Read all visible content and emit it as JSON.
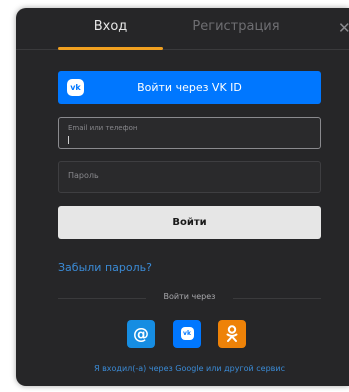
{
  "tabs": {
    "login": "Вход",
    "register": "Регистрация"
  },
  "close_icon": "close-icon",
  "vk_button": {
    "label": "Войти через VK ID",
    "logo_text": "vk",
    "icon": "vk-logo-icon"
  },
  "email": {
    "placeholder": "Email или телефон",
    "value": ""
  },
  "password": {
    "placeholder": "Пароль",
    "value": ""
  },
  "submit_label": "Войти",
  "forgot_link": "Забыли пароль?",
  "divider_text": "Войти через",
  "socials": {
    "mail_glyph": "@",
    "vk_glyph": "vk",
    "ok_glyph": "ok"
  },
  "google_note": "Я входил(-а) через Google или другой сервис",
  "colors": {
    "modal_bg": "#262628",
    "accent_tab": "#f0a020",
    "vk_blue": "#0077ff",
    "link_blue": "#3b8bd6",
    "mail_blue": "#168de2",
    "ok_orange": "#ee8208"
  }
}
